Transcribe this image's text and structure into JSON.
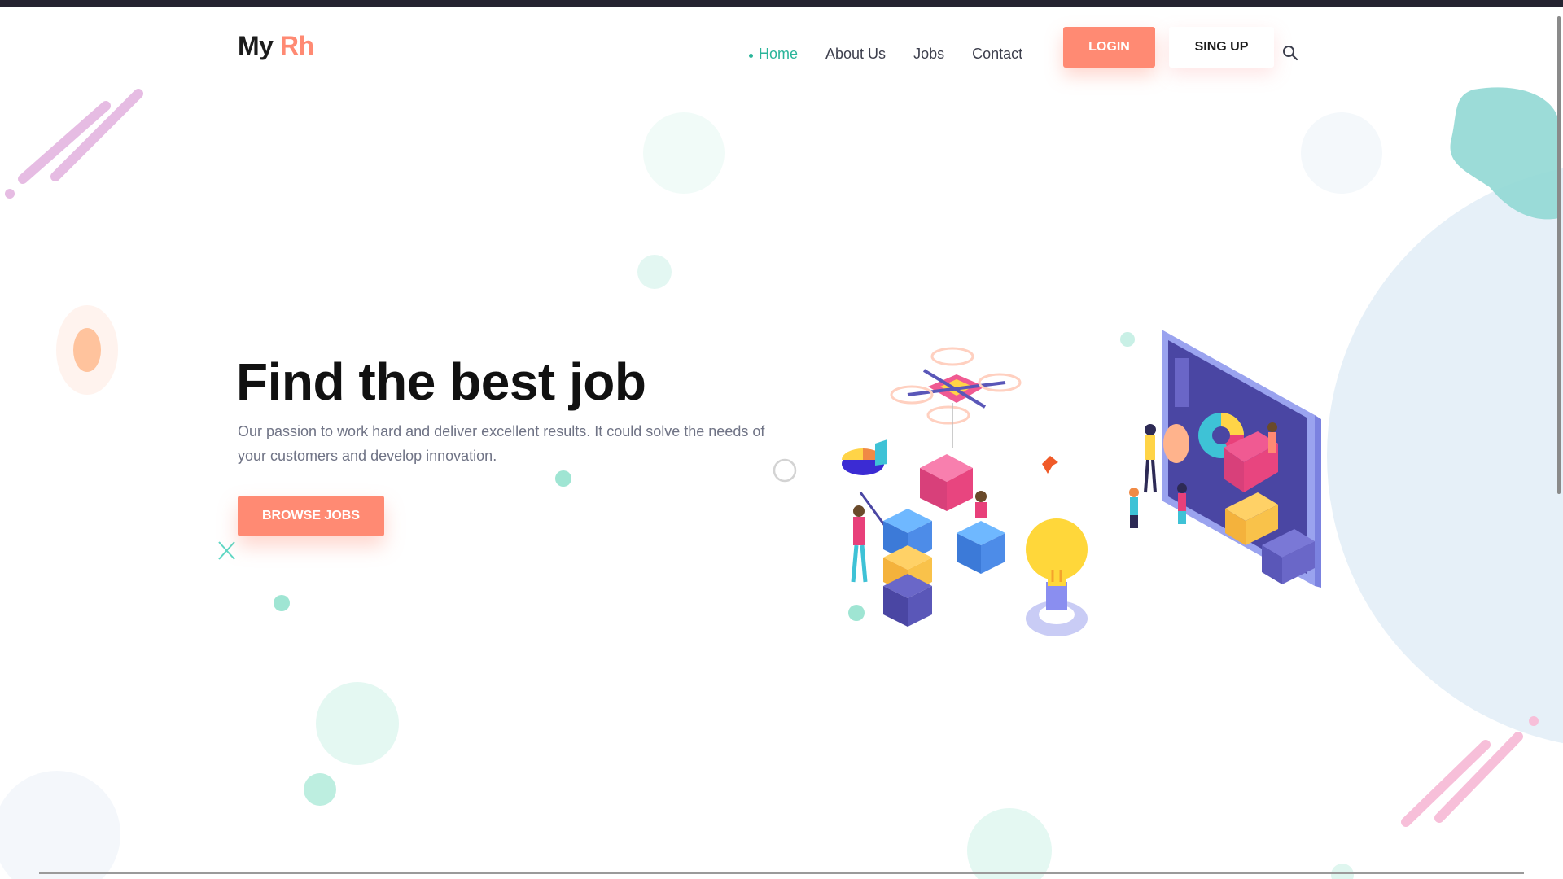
{
  "app": {
    "logo_main": "My",
    "logo_accent": "Rh"
  },
  "nav": {
    "items": [
      {
        "label": "Home",
        "active": true
      },
      {
        "label": "About Us",
        "active": false
      },
      {
        "label": "Jobs",
        "active": false
      },
      {
        "label": "Contact",
        "active": false
      }
    ],
    "login_label": "LOGIN",
    "signup_label": "SING UP",
    "search_icon": "search-icon"
  },
  "hero": {
    "title": "Find the best job",
    "description": "Our passion to work hard and deliver excellent results. It could solve the needs of your customers and develop innovation.",
    "cta_label": "BROWSE JOBS"
  },
  "colors": {
    "accent": "#ff8a73",
    "active_nav": "#2ab59a",
    "title": "#111111",
    "text": "#6f7385",
    "mint": "#bff0e4",
    "light_blue": "#e6f0f8"
  }
}
